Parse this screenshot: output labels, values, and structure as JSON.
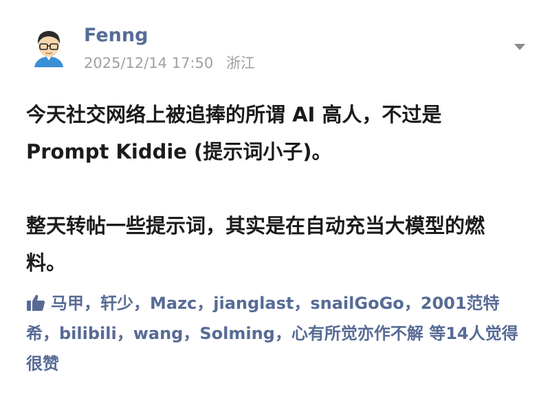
{
  "author": {
    "name": "Fenng",
    "timestamp": "2025/12/14 17:50",
    "location": "浙江"
  },
  "post": {
    "paragraphs": [
      "今天社交网络上被追捧的所谓 AI 高人，不过是\nPrompt Kiddie (提示词小子)。",
      "整天转帖一些提示词，其实是在自动充当大模型的燃\n料。"
    ]
  },
  "likes": {
    "names_text": "马甲，轩少，Mazc，jianglast，snailGoGo，2001范特希，bilibili，wang，Solming，心有所觉亦作不解 等14人觉得很赞",
    "icon": "thumbs-up-icon"
  },
  "colors": {
    "accent": "#576b95",
    "meta": "#a0a0a0",
    "text": "#1b1b1b"
  }
}
